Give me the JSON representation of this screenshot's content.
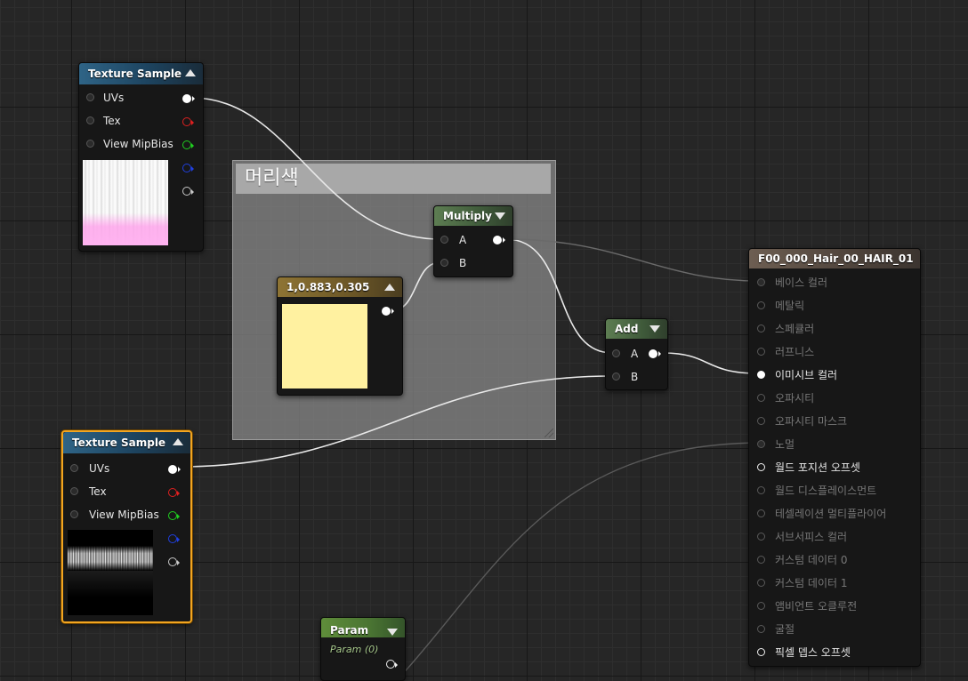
{
  "comment": {
    "title": "머리색"
  },
  "nodes": {
    "texture_sample_1": {
      "title": "Texture Sample",
      "inputs": [
        "UVs",
        "Tex",
        "View MipBias"
      ]
    },
    "texture_sample_2": {
      "title": "Texture Sample",
      "inputs": [
        "UVs",
        "Tex",
        "View MipBias"
      ]
    },
    "multiply": {
      "title": "Multiply",
      "inputs": [
        "A",
        "B"
      ]
    },
    "constant3": {
      "title": "1,0.883,0.305",
      "color": "#fff1a0"
    },
    "add": {
      "title": "Add",
      "inputs": [
        "A",
        "B"
      ]
    },
    "param": {
      "title": "Param",
      "subtitle": "Param (0)"
    },
    "material": {
      "title": "F00_000_Hair_00_HAIR_01",
      "inputs": [
        "베이스 컬러",
        "메탈릭",
        "스페큘러",
        "러프니스",
        "이미시브 컬러",
        "오파시티",
        "오파시티 마스크",
        "노멀",
        "월드 포지션 오프셋",
        "월드 디스플레이스먼트",
        "테셀레이션 멀티플라이어",
        "서브서피스 컬러",
        "커스텀 데이터 0",
        "커스텀 데이터 1",
        "앰비언트 오클루전",
        "굴절",
        "픽셀 뎁스 오프셋"
      ]
    }
  },
  "colors": {
    "selection": "#f2a520",
    "pin_red": "#e02020",
    "pin_green": "#20d020",
    "pin_blue": "#2040e0"
  }
}
